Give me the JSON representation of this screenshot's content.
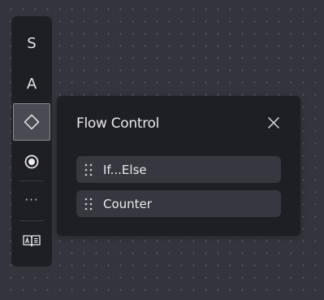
{
  "toolbar": {
    "tools": [
      {
        "label": "S",
        "icon": "text-s-icon"
      },
      {
        "label": "A",
        "icon": "text-a-icon"
      },
      {
        "label": "",
        "icon": "diamond-icon",
        "active": true
      },
      {
        "label": "",
        "icon": "radio-icon"
      },
      {
        "label": "···",
        "icon": "more-icon"
      },
      {
        "label": "",
        "icon": "book-icon"
      }
    ]
  },
  "flow_panel": {
    "title": "Flow Control",
    "close_icon": "close-icon",
    "items": [
      {
        "label": "If...Else",
        "icon": "drag-handle-icon"
      },
      {
        "label": "Counter",
        "icon": "drag-handle-icon"
      }
    ]
  },
  "colors": {
    "canvas": "#34343c",
    "panel": "#1e1f25",
    "item": "#37383f",
    "active_tool": "#494a52",
    "text": "#e8e8ec"
  }
}
